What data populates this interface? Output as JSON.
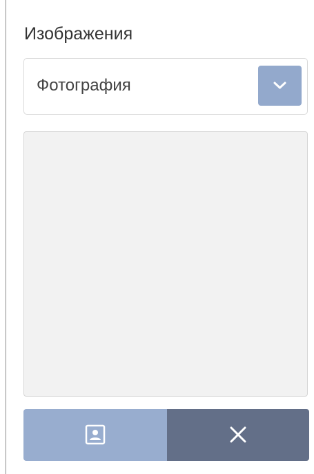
{
  "images": {
    "label": "Изображения",
    "type_select": {
      "value": "Фотография",
      "arrow_icon": "chevron-down-icon"
    },
    "preview": {
      "background": "#f2f2f2"
    },
    "buttons": {
      "upload_icon": "portrait-icon",
      "remove_icon": "close-icon"
    }
  },
  "colors": {
    "accent": "#93a9cc",
    "upload_button": "#98adcf",
    "remove_button": "#636f88"
  }
}
